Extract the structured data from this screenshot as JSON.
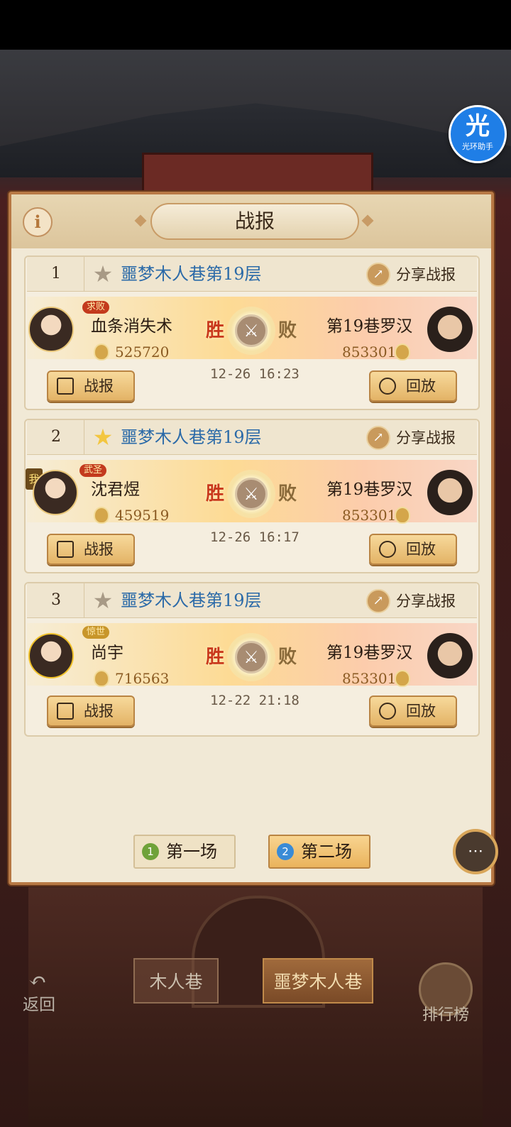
{
  "overlay": {
    "badge_big": "光",
    "badge_small": "光环助手"
  },
  "header": {
    "title": "战报",
    "info_icon": "i"
  },
  "reports": [
    {
      "index": "1",
      "starred": false,
      "stage": "噩梦木人巷第19层",
      "share_label": "分享战报",
      "player": {
        "name": "血条消失术",
        "badge": "求败",
        "power": "525720",
        "is_me": false
      },
      "result_win": "胜",
      "result_lose": "败",
      "opponent": {
        "name": "第19巷罗汉",
        "power": "853301"
      },
      "time": "12-26 16:23",
      "report_btn": "战报",
      "replay_btn": "回放"
    },
    {
      "index": "2",
      "starred": true,
      "stage": "噩梦木人巷第19层",
      "share_label": "分享战报",
      "player": {
        "name": "沈君煜",
        "badge": "武圣",
        "power": "459519",
        "is_me": true,
        "me_tag": "我"
      },
      "result_win": "胜",
      "result_lose": "败",
      "opponent": {
        "name": "第19巷罗汉",
        "power": "853301"
      },
      "time": "12-26 16:17",
      "report_btn": "战报",
      "replay_btn": "回放"
    },
    {
      "index": "3",
      "starred": false,
      "stage": "噩梦木人巷第19层",
      "share_label": "分享战报",
      "player": {
        "name": "尚宇",
        "badge": "惊世",
        "power": "716563",
        "is_me": false
      },
      "result_win": "胜",
      "result_lose": "败",
      "opponent": {
        "name": "第19巷罗汉",
        "power": "853301"
      },
      "time": "12-22 21:18",
      "report_btn": "战报",
      "replay_btn": "回放"
    }
  ],
  "tabs": [
    {
      "num": "1",
      "label": "第一场",
      "active": false
    },
    {
      "num": "2",
      "label": "第二场",
      "active": true
    }
  ],
  "bottom_nav": {
    "back": "返回",
    "tab1": "木人巷",
    "tab2": "噩梦木人巷",
    "rank": "排行榜"
  },
  "colors": {
    "accent": "#b87945",
    "stage_title": "#2b6aa8",
    "win": "#c9381c",
    "panel_bg": "#f1e9d6"
  }
}
